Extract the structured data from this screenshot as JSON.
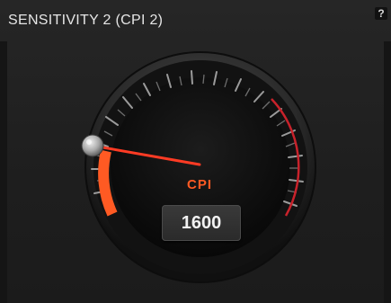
{
  "window": {
    "title": "SENSITIVITY 2 (CPI 2)",
    "help_label": "?"
  },
  "gauge": {
    "unit_label": "CPI",
    "value": "1600",
    "accent_color": "#ff5a23",
    "needle_color": "#ff3b24",
    "icon": "slider-knob"
  }
}
